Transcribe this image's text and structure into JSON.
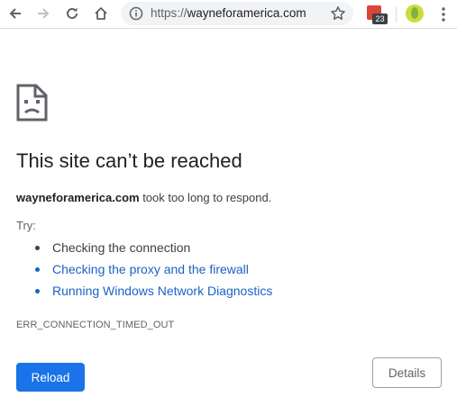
{
  "browser": {
    "url_scheme": "https://",
    "url_host": "wayneforamerica.com",
    "extension_badge": "23",
    "icons": [
      "back-icon",
      "forward-icon",
      "reload-icon",
      "home-icon",
      "info-icon",
      "star-icon",
      "calendar-extension-icon",
      "profile-avatar",
      "menu-dots-icon"
    ]
  },
  "error": {
    "icon": "sad-page-icon",
    "title": "This site can’t be reached",
    "host": "wayneforamerica.com",
    "message": " took too long to respond.",
    "try_label": "Try:",
    "suggestions": [
      {
        "text": "Checking the connection",
        "is_link": false
      },
      {
        "text": "Checking the proxy and the firewall",
        "is_link": true
      },
      {
        "text": "Running Windows Network Diagnostics",
        "is_link": true
      }
    ],
    "code": "ERR_CONNECTION_TIMED_OUT",
    "reload_label": "Reload",
    "details_label": "Details"
  },
  "colors": {
    "primary_button": "#1a73e8",
    "link": "#1a62c7",
    "title_text": "#202124"
  }
}
